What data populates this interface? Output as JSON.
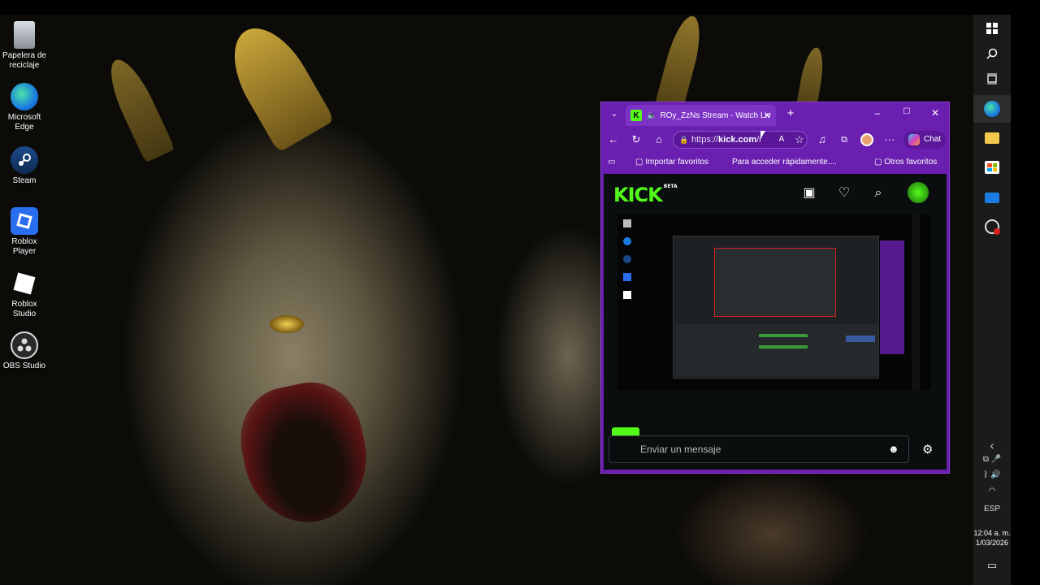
{
  "desktop_icons": [
    {
      "label": "Papelera de reciclaje",
      "icon": "recycle-bin-icon"
    },
    {
      "label": "Microsoft Edge",
      "icon": "edge-icon"
    },
    {
      "label": "Steam",
      "icon": "steam-icon"
    },
    {
      "label": "Roblox Player",
      "icon": "roblox-player-icon"
    },
    {
      "label": "Roblox Studio",
      "icon": "roblox-studio-icon"
    },
    {
      "label": "OBS Studio",
      "icon": "obs-icon"
    }
  ],
  "browser": {
    "tab_title": "ROy_ZzNs Stream - Watch Liv",
    "new_tab": "+",
    "url_prefix": "https://",
    "url_domain": "kick.com",
    "url_rest": "/r",
    "chat_button": "Chat",
    "favorites": {
      "import": "Importar favoritos",
      "quick_access": "Para acceder rápidamente....",
      "other": "Otros favoritos"
    },
    "accent": "#6a1fb0"
  },
  "kick": {
    "logo": "KICK",
    "logo_badge": "BETA",
    "brand_color": "#53fc18",
    "chat_placeholder": "Enviar un mensaje"
  },
  "tray": {
    "language": "ESP",
    "time": "12:04 a. m.",
    "date": "1/03/2026"
  }
}
